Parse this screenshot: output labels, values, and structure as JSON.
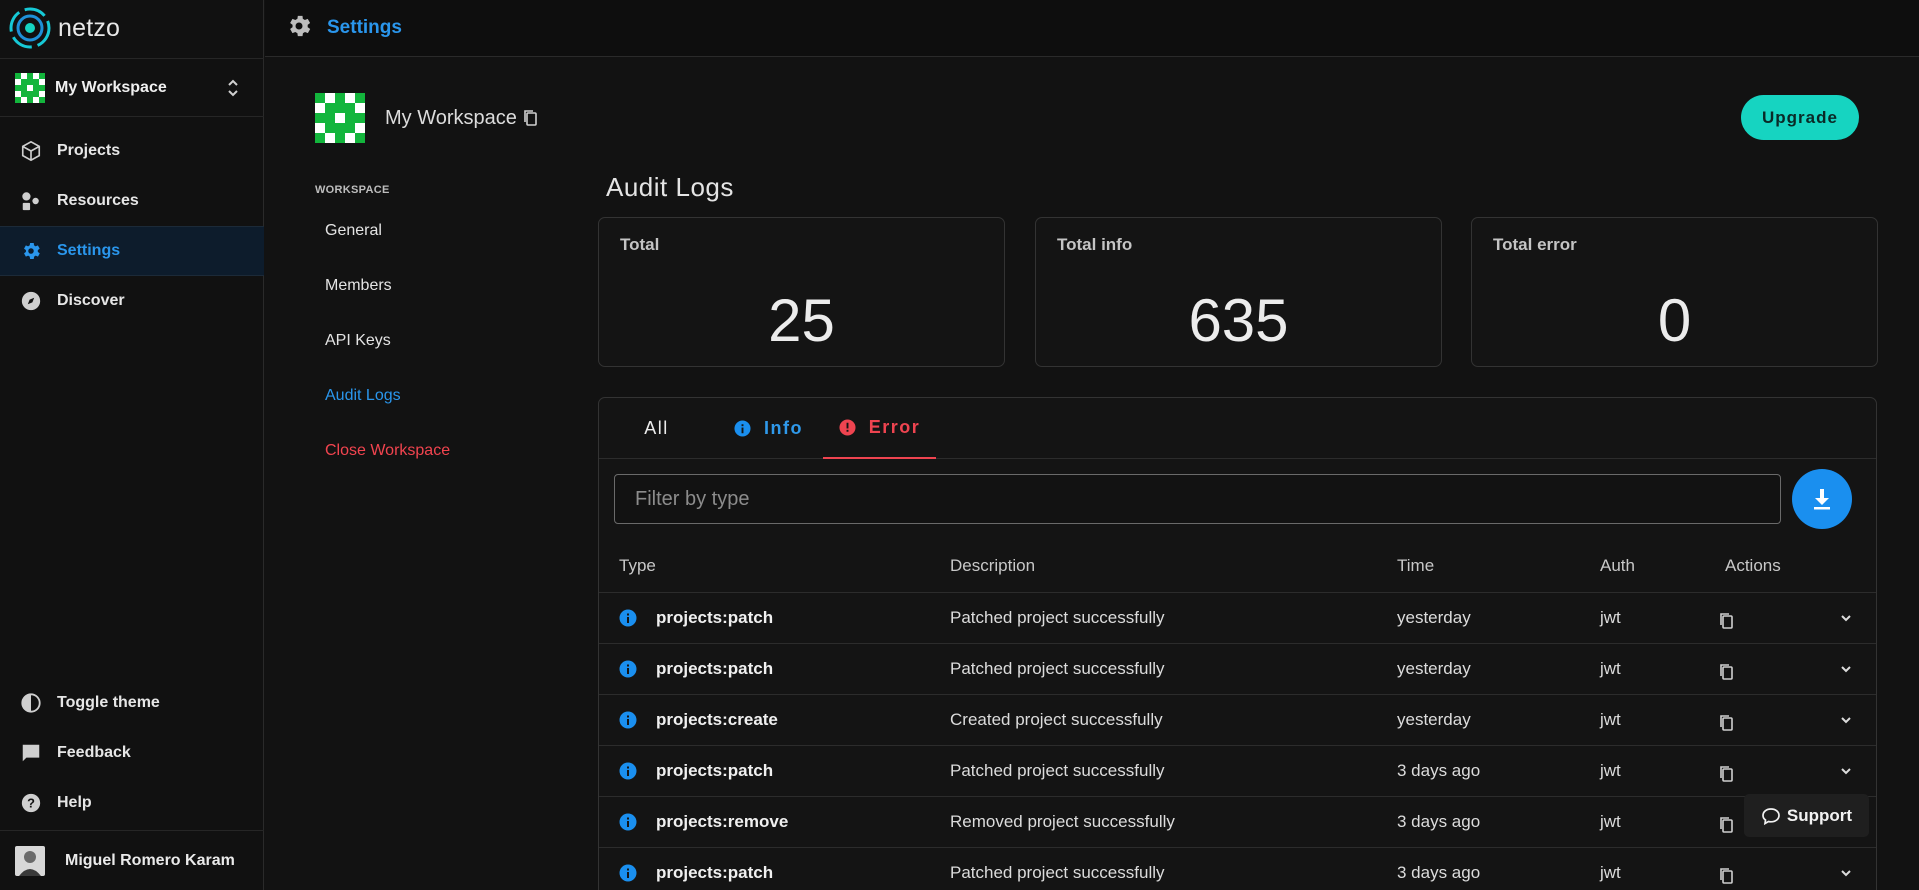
{
  "app": {
    "name": "netzo"
  },
  "sidebar": {
    "workspace_name": "My Workspace",
    "nav": [
      {
        "label": "Projects",
        "icon": "cube-icon"
      },
      {
        "label": "Resources",
        "icon": "shapes-icon"
      },
      {
        "label": "Settings",
        "icon": "gear-icon",
        "active": true
      },
      {
        "label": "Discover",
        "icon": "compass-icon"
      }
    ],
    "bottom": [
      {
        "label": "Toggle theme",
        "icon": "contrast-icon"
      },
      {
        "label": "Feedback",
        "icon": "chat-icon"
      },
      {
        "label": "Help",
        "icon": "help-icon"
      }
    ],
    "user_name": "Miguel Romero Karam"
  },
  "topbar": {
    "title": "Settings"
  },
  "workspace": {
    "title": "My Workspace",
    "upgrade_label": "Upgrade"
  },
  "subnav": {
    "heading": "WORKSPACE",
    "items": [
      "General",
      "Members",
      "API Keys",
      "Audit Logs",
      "Close Workspace"
    ]
  },
  "audit": {
    "title": "Audit Logs",
    "stats": [
      {
        "label": "Total",
        "value": "25"
      },
      {
        "label": "Total info",
        "value": "635"
      },
      {
        "label": "Total error",
        "value": "0"
      }
    ],
    "tabs": [
      "All",
      "Info",
      "Error"
    ],
    "filter_placeholder": "Filter by type",
    "columns": [
      "Type",
      "Description",
      "Time",
      "Auth",
      "Actions"
    ],
    "rows": [
      {
        "type": "projects:patch",
        "description": "Patched project successfully",
        "time": "yesterday",
        "auth": "jwt"
      },
      {
        "type": "projects:patch",
        "description": "Patched project successfully",
        "time": "yesterday",
        "auth": "jwt"
      },
      {
        "type": "projects:create",
        "description": "Created project successfully",
        "time": "yesterday",
        "auth": "jwt"
      },
      {
        "type": "projects:patch",
        "description": "Patched project successfully",
        "time": "3 days ago",
        "auth": "jwt"
      },
      {
        "type": "projects:remove",
        "description": "Removed project successfully",
        "time": "3 days ago",
        "auth": "jwt"
      },
      {
        "type": "projects:patch",
        "description": "Patched project successfully",
        "time": "3 days ago",
        "auth": "jwt"
      }
    ]
  },
  "support": {
    "label": "Support"
  },
  "colors": {
    "accent": "#2a96ec",
    "teal": "#16d4c1",
    "error": "#ef4450",
    "info": "#1a8fef"
  }
}
